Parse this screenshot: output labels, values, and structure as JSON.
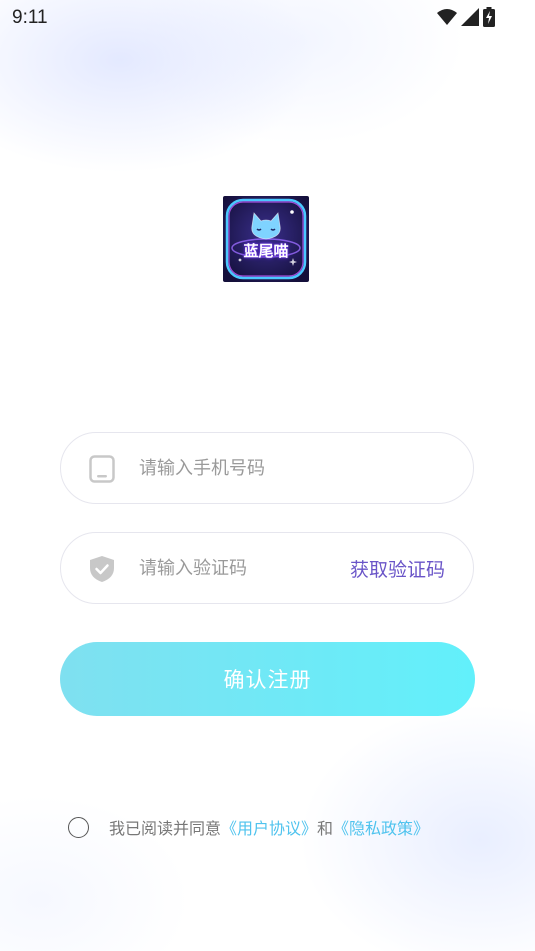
{
  "status_bar": {
    "time": "9:11",
    "icons": [
      "wifi-icon",
      "cellular-signal-icon",
      "battery-charging-icon"
    ]
  },
  "logo": {
    "text": "蓝尾喵",
    "icon": "cat-app-logo"
  },
  "form": {
    "phone": {
      "placeholder": "请输入手机号码",
      "value": "",
      "icon": "phone-icon"
    },
    "code": {
      "placeholder": "请输入验证码",
      "value": "",
      "icon": "shield-check-icon",
      "get_code_label": "获取验证码"
    },
    "submit_label": "确认注册"
  },
  "agreement": {
    "checked": false,
    "prefix": "我已阅读并同意",
    "user_agreement_link": "《用户协议》",
    "conjunction": "和",
    "privacy_policy_link": "《隐私政策》"
  },
  "colors": {
    "accent_link": "#4fc3ee",
    "get_code": "#6a55c8",
    "button_gradient_start": "#7fe0f0",
    "button_gradient_end": "#62f0fb",
    "button_text": "#ffffff"
  }
}
